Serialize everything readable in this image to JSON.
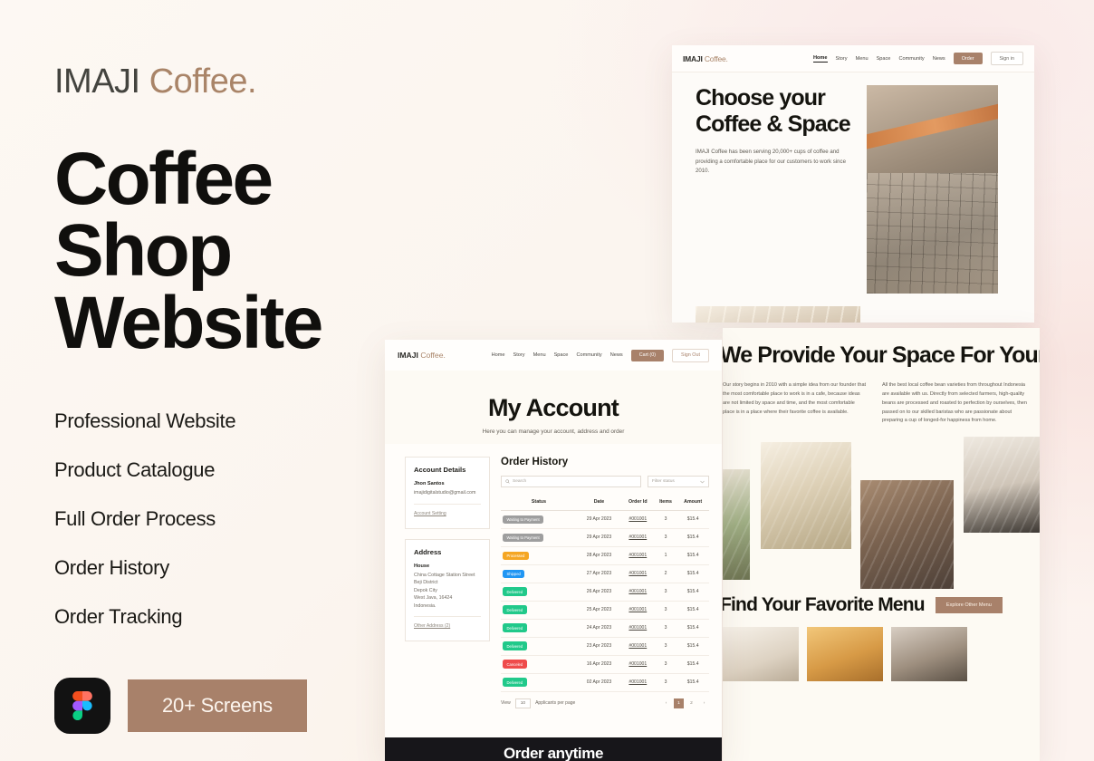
{
  "brand": {
    "first": "IMAJI",
    "second": "Coffee."
  },
  "hero": {
    "title_line1": "Coffee Shop",
    "title_line2": "Website"
  },
  "features": [
    {
      "label": "Professional Website"
    },
    {
      "label": "Product Catalogue"
    },
    {
      "label": "Full Order Process"
    },
    {
      "label": "Order History"
    },
    {
      "label": "Order Tracking"
    }
  ],
  "cta": {
    "screens_label": "20+ Screens",
    "figma_icon": "figma-logo-icon"
  },
  "colors": {
    "accent": "#a8816a",
    "background": "#fbf6f1",
    "text_dark": "#100f0d",
    "brand_light": "#a98468"
  },
  "mockup_hero": {
    "logo_first": "IMAJI",
    "logo_second": "Coffee.",
    "nav": [
      "Home",
      "Story",
      "Menu",
      "Space",
      "Community",
      "News"
    ],
    "order_button": "Order",
    "signin_button": "Sign in",
    "heading": "Choose your Coffee & Space",
    "paragraph": "IMAJI Coffee has been serving 20,000+ cups of coffee and providing a comfortable place for our customers to work since 2010."
  },
  "mockup_account": {
    "logo_first": "IMAJI",
    "logo_second": "Coffee.",
    "nav": [
      "Home",
      "Story",
      "Menu",
      "Space",
      "Community",
      "News"
    ],
    "cart_button": "Cart (0)",
    "signout_button": "Sign Out",
    "title": "My Account",
    "subtitle": "Here you can manage your account, address and order",
    "account_details": {
      "heading": "Account Details",
      "name": "Jhon Santos",
      "email": "imajidigitalstudio@gmail.com",
      "link": "Account Setting"
    },
    "address": {
      "heading": "Address",
      "label": "House",
      "lines": [
        "China Cottage Station Street",
        "Beji District",
        "Depok City",
        "West Java, 16424",
        "Indonesia."
      ],
      "link": "Other Address (2)"
    },
    "order_history": {
      "heading": "Order History",
      "search_placeholder": "Search",
      "search_icon": "search-icon",
      "filter_label": "Filter status",
      "filter_icon": "chevron-down-icon",
      "columns": [
        "Status",
        "Date",
        "Order Id",
        "Items",
        "Amount"
      ],
      "rows": [
        {
          "status": "Waiting to Payment",
          "color": "#9e9e9e",
          "date": "29 Apr 2023",
          "order_id": "#001001",
          "items": "3",
          "amount": "$15.4"
        },
        {
          "status": "Waiting to Payment",
          "color": "#9e9e9e",
          "date": "29 Apr 2023",
          "order_id": "#001001",
          "items": "3",
          "amount": "$15.4"
        },
        {
          "status": "Processed",
          "color": "#f5a623",
          "date": "28 Apr 2023",
          "order_id": "#001001",
          "items": "1",
          "amount": "$15.4"
        },
        {
          "status": "Shipped",
          "color": "#2196f3",
          "date": "27 Apr 2023",
          "order_id": "#001001",
          "items": "2",
          "amount": "$15.4"
        },
        {
          "status": "Delivered",
          "color": "#21c98a",
          "date": "26 Apr 2023",
          "order_id": "#001001",
          "items": "3",
          "amount": "$15.4"
        },
        {
          "status": "Delivered",
          "color": "#21c98a",
          "date": "25 Apr 2023",
          "order_id": "#001001",
          "items": "3",
          "amount": "$15.4"
        },
        {
          "status": "Delivered",
          "color": "#21c98a",
          "date": "24 Apr 2023",
          "order_id": "#001001",
          "items": "3",
          "amount": "$15.4"
        },
        {
          "status": "Delivered",
          "color": "#21c98a",
          "date": "23 Apr 2023",
          "order_id": "#001001",
          "items": "3",
          "amount": "$15.4"
        },
        {
          "status": "Canceled",
          "color": "#ef4b4b",
          "date": "16 Apr 2023",
          "order_id": "#001001",
          "items": "3",
          "amount": "$15.4"
        },
        {
          "status": "Delivered",
          "color": "#21c98a",
          "date": "02 Apr 2023",
          "order_id": "#001001",
          "items": "3",
          "amount": "$15.4"
        }
      ],
      "footer": {
        "view_label": "View",
        "per_page_value": "10",
        "per_page_label": "Applicants per page",
        "prev_icon": "chevron-left-icon",
        "next_icon": "chevron-right-icon",
        "pages": [
          "1",
          "2"
        ],
        "active_page": "1"
      }
    },
    "dark_banner": "Order anytime"
  },
  "mockup_space": {
    "heading": "We Provide Your Space For Your Work or Mini event With Your Favorite coffee.",
    "paragraph_left": "Our story begins in 2010 with a simple idea from our founder that the most comfortable place to work is in a cafe, because ideas are not limited by space and time, and the most comfortable place is in a place where their favorite coffee is available.",
    "paragraph_right": "All the best local coffee bean varieties from throughout Indonesia are available with us. Directly from selected farmers, high-quality beans are processed and roasted to perfection by ourselves, then passed on to our skilled baristas who are passionate about preparing a cup of longed-for happiness from home.",
    "menu_heading": "Find Your Favorite Menu",
    "explore_button": "Explore Other Menu"
  }
}
